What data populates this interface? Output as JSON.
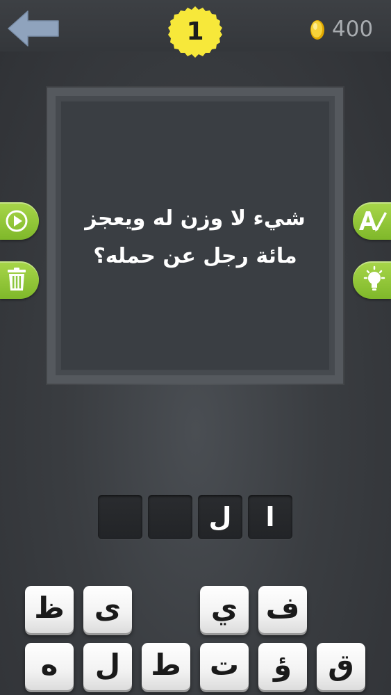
{
  "header": {
    "level": "1",
    "coins": "400",
    "back_icon": "back-arrow-icon",
    "coin_icon": "coin-icon"
  },
  "question": {
    "line1": "شيء لا وزن له ويعجز",
    "line2": "مائة رجل عن حمله؟"
  },
  "side_buttons": {
    "left": [
      {
        "name": "play-video-button",
        "icon": "play-icon"
      },
      {
        "name": "remove-letters-button",
        "icon": "trash-icon"
      }
    ],
    "right": [
      {
        "name": "reveal-letter-button",
        "icon": "letter-a-pen-icon"
      },
      {
        "name": "hint-button",
        "icon": "lightbulb-icon"
      }
    ]
  },
  "answer_slots": [
    "",
    "",
    "ل",
    "ا"
  ],
  "letters": {
    "row1": [
      "ظ",
      "ى",
      "",
      "ي",
      "ف"
    ],
    "row2": [
      "ه",
      "ل",
      "ط",
      "ت",
      "ؤ",
      "ق"
    ]
  },
  "colors": {
    "background": "#3a3d41",
    "accent_green": "#8cc63f",
    "badge_yellow": "#f7e83a",
    "coin_gold": "#f5c518"
  }
}
